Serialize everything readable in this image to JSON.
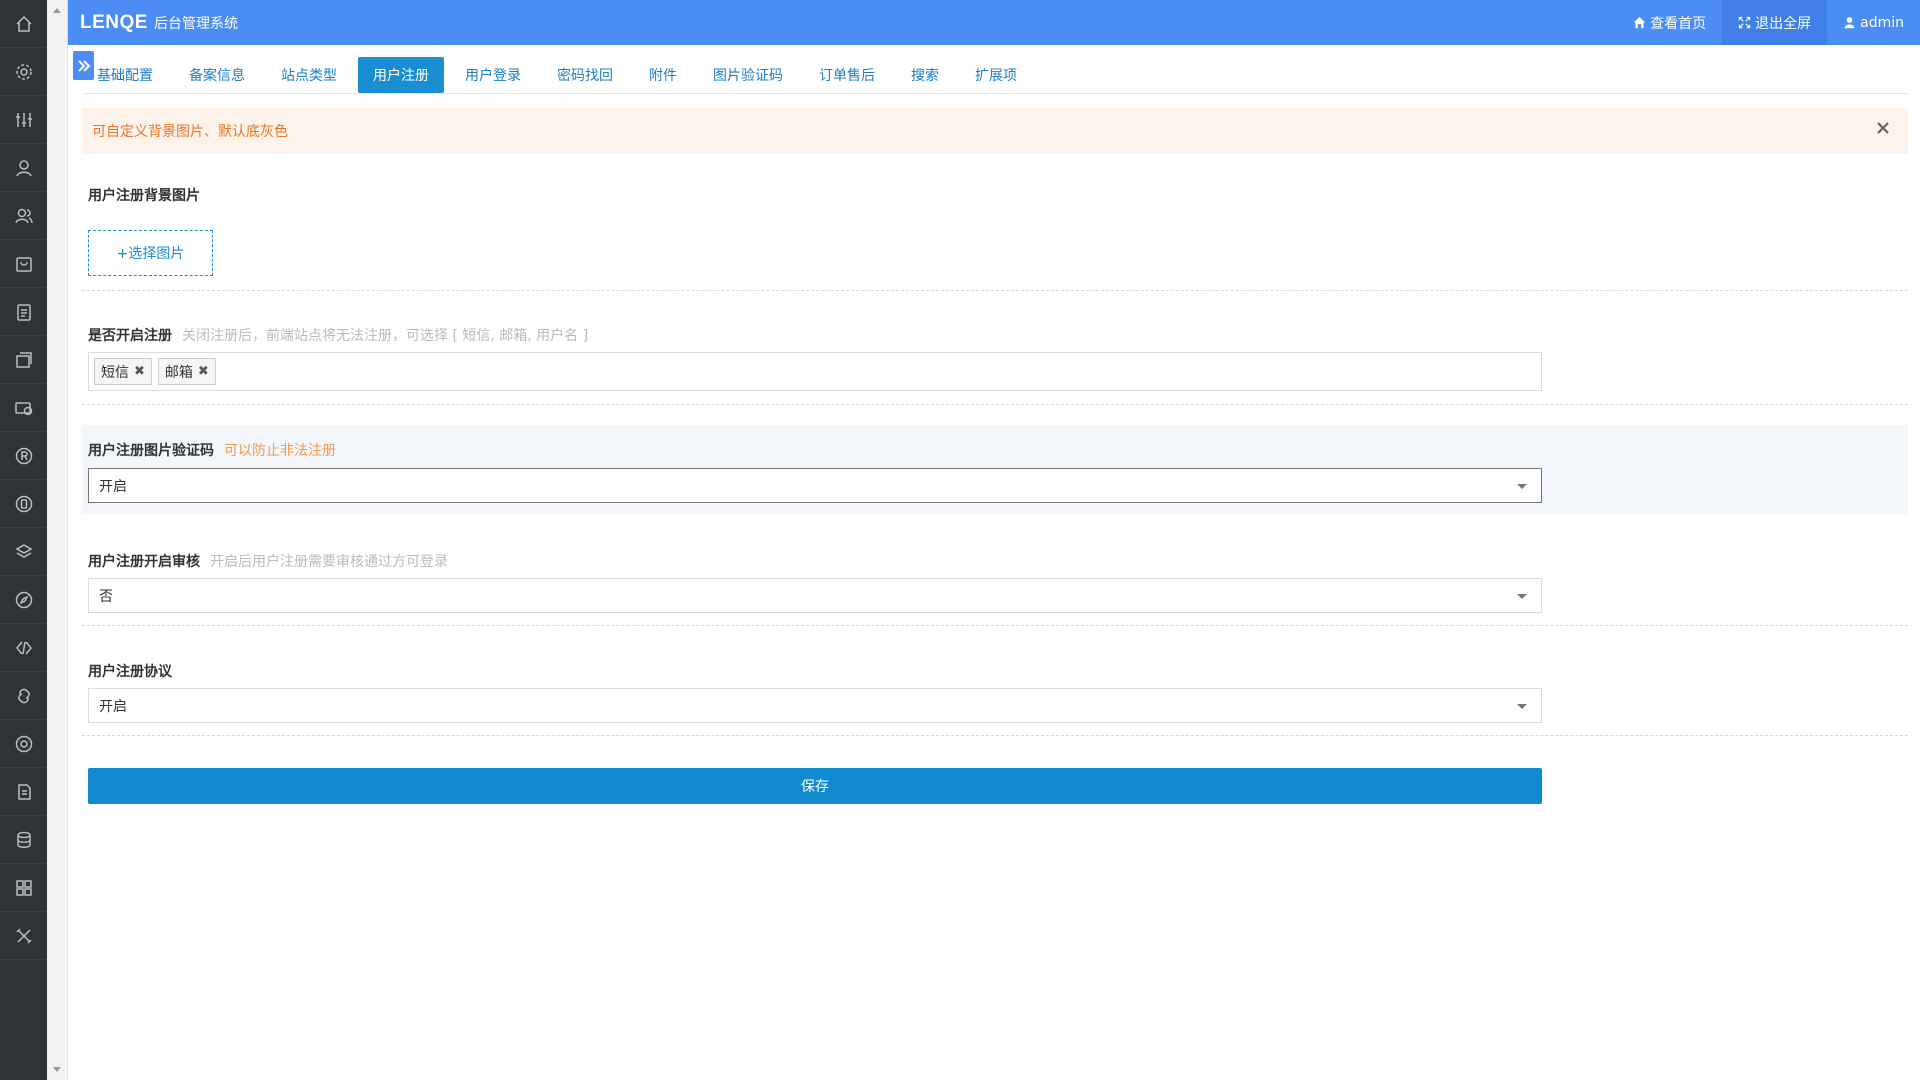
{
  "app": {
    "logo": "LENQE",
    "subtitle": "后台管理系统"
  },
  "header": {
    "view_home": "查看首页",
    "exit_fullscreen": "退出全屏",
    "user": "admin"
  },
  "tabs": [
    "基础配置",
    "备案信息",
    "站点类型",
    "用户注册",
    "用户登录",
    "密码找回",
    "附件",
    "图片验证码",
    "订单售后",
    "搜索",
    "扩展项"
  ],
  "active_tab": "用户注册",
  "alert": {
    "text": "可自定义背景图片、默认底灰色"
  },
  "form": {
    "bg_image": {
      "label": "用户注册背景图片",
      "button": "+选择图片"
    },
    "enable_register": {
      "label": "是否开启注册",
      "hint": "关闭注册后，前端站点将无法注册，可选择 [ 短信, 邮箱, 用户名 ]",
      "tags": [
        "短信",
        "邮箱"
      ]
    },
    "captcha": {
      "label": "用户注册图片验证码",
      "hint": "可以防止非法注册",
      "value": "开启"
    },
    "review": {
      "label": "用户注册开启审核",
      "hint": "开启后用户注册需要审核通过方可登录",
      "value": "否"
    },
    "agreement": {
      "label": "用户注册协议",
      "value": "开启"
    },
    "save": "保存"
  },
  "sidebar_icons": [
    "home-icon",
    "gear-icon",
    "sliders-icon",
    "user-icon",
    "users-icon",
    "bag-icon",
    "clipboard-icon",
    "coupon-icon",
    "money-icon",
    "registered-icon",
    "app-icon",
    "layers-icon",
    "compass-icon",
    "code-icon",
    "link-icon",
    "circle-icon",
    "document-icon",
    "database-icon",
    "grid-icon",
    "tools-icon"
  ]
}
